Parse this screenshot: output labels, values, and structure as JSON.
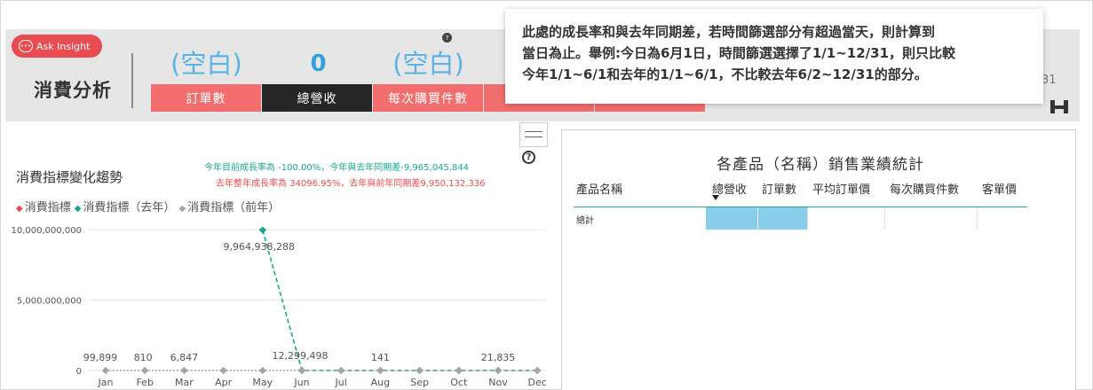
{
  "header": {
    "ask_label": "Ask Insight",
    "page_title": "消費分析",
    "kpis": [
      {
        "value": "(空白)",
        "label": "訂單數"
      },
      {
        "value": "0",
        "label": "總營收"
      },
      {
        "value": "(空白)",
        "label": "每次購買件數"
      }
    ],
    "side_label": "31"
  },
  "tooltip": {
    "line1": "此處的成長率和與去年同期差，若時間篩選部分有超過當天，則計算到",
    "line2": "當日為止。舉例:今日為6月1日，時間篩選選擇了1/1~12/31，則只比較",
    "line3": "今年1/1~6/1和去年的1/1~6/1，不比較去年6/2~12/31的部分。"
  },
  "trend": {
    "title": "消費指標變化趨勢",
    "growth_line1": "今年目前成長率為 -100.00%，今年與去年同期差-9,965,045,844",
    "growth_line2": "去年整年成長率為 34096.95%，去年與前年同期差9,950,132,336",
    "legend": [
      "消費指標",
      "消費指標（去年）",
      "消費指標（前年）"
    ]
  },
  "chart_data": {
    "type": "line",
    "title": "消費指標變化趨勢",
    "categories": [
      "Jan",
      "Feb",
      "Mar",
      "Apr",
      "May",
      "Jun",
      "Jul",
      "Aug",
      "Sep",
      "Oct",
      "Nov",
      "Dec"
    ],
    "y_ticks": [
      "10,000,000,000",
      "5,000,000,000",
      "0"
    ],
    "ylim": [
      0,
      10000000000
    ],
    "series": [
      {
        "name": "消費指標",
        "color": "#e84b50",
        "values": [
          null,
          null,
          null,
          null,
          null,
          null,
          null,
          null,
          null,
          null,
          null,
          null
        ]
      },
      {
        "name": "消費指標（去年）",
        "color": "#1aa78d",
        "values": [
          null,
          null,
          null,
          null,
          9964938288,
          0,
          0,
          0,
          0,
          0,
          0,
          0
        ]
      },
      {
        "name": "消費指標（前年）",
        "color": "#a6a6a6",
        "values": [
          99899,
          810,
          6847,
          0,
          0,
          12299498,
          0,
          141,
          0,
          0,
          21835,
          0
        ]
      }
    ],
    "data_labels": [
      {
        "index": 4,
        "text": "9,964,938,288"
      },
      {
        "index": 0,
        "text": "99,899"
      },
      {
        "index": 1,
        "text": "810"
      },
      {
        "index": 2,
        "text": "6,847"
      },
      {
        "index": 5,
        "text": "12,299,498"
      },
      {
        "index": 7,
        "text": "141"
      },
      {
        "index": 10,
        "text": "21,835"
      }
    ]
  },
  "table": {
    "title": "各產品（名稱）銷售業績統計",
    "columns": [
      "產品名稱",
      "總營收",
      "訂單數",
      "平均訂單價",
      "每次購買件數",
      "客單價"
    ],
    "total_label": "總計"
  }
}
